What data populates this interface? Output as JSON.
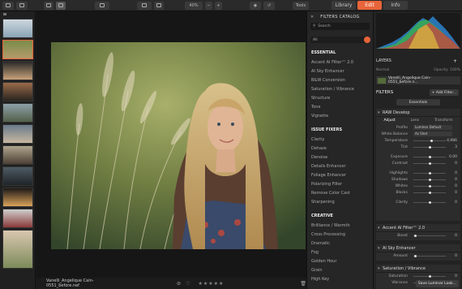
{
  "toolbar": {
    "zoom": "40%",
    "tools_label": "Tools",
    "tabs": [
      "Library",
      "Edit",
      "Info"
    ]
  },
  "canvas": {
    "filename": "Vanelli_Angelique Cain-0551_before.nef"
  },
  "catalog": {
    "title": "FILTERS CATALOG",
    "search_placeholder": "Search",
    "filter_value": "All",
    "sections": [
      {
        "name": "ESSENTIAL",
        "items": [
          "Accent AI Filter™ 2.0",
          "AI Sky Enhancer",
          "B&W Conversion",
          "Saturation / Vibrance",
          "Structure",
          "Tone",
          "Vignette"
        ]
      },
      {
        "name": "ISSUE FIXERS",
        "items": [
          "Clarity",
          "Dehaze",
          "Denoise",
          "Details Enhancer",
          "Foliage Enhancer",
          "Polarizing Filter",
          "Remove Color Cast",
          "Sharpening"
        ]
      },
      {
        "name": "CREATIVE",
        "items": [
          "Brilliance / Warmth",
          "Cross Processing",
          "Dramatic",
          "Fog",
          "Golden Hour",
          "Grain",
          "High Key"
        ]
      }
    ]
  },
  "right": {
    "layers_title": "LAYERS",
    "blend_mode": "Normal",
    "opacity": "Opacity: 100%",
    "layer_name": "Vanelli_Angelique Cain-0551_before.n...",
    "filters_title": "FILTERS",
    "add_filter": "+ Add Filter...",
    "preset": "Essentials",
    "raw": {
      "title": "RAW Develop",
      "tabs": [
        "Adjust",
        "Lens",
        "Transform"
      ],
      "profile_label": "Profile",
      "profile_value": "Luminar Default",
      "wb_label": "White Balance",
      "wb_value": "As Shot",
      "sliders": [
        {
          "label": "Temperature",
          "value": "4,986",
          "knob": 0.55
        },
        {
          "label": "Tint",
          "value": "3",
          "knob": 0.52
        },
        {
          "label": "Exposure",
          "value": "0.00",
          "knob": 0.5
        },
        {
          "label": "Contrast",
          "value": "0",
          "knob": 0.5
        },
        {
          "label": "Highlights",
          "value": "0",
          "knob": 0.5
        },
        {
          "label": "Shadows",
          "value": "0",
          "knob": 0.5
        },
        {
          "label": "Whites",
          "value": "0",
          "knob": 0.5
        },
        {
          "label": "Blacks",
          "value": "0",
          "knob": 0.5
        },
        {
          "label": "Clarity",
          "value": "0",
          "knob": 0.5
        }
      ]
    },
    "accent": {
      "title": "Accent AI Filter™ 2.0",
      "label": "Boost",
      "value": "0",
      "knob": 0.05
    },
    "sky": {
      "title": "AI Sky Enhancer",
      "label": "Amount",
      "value": "0",
      "knob": 0.05
    },
    "sat": {
      "title": "Saturation / Vibrance",
      "rows": [
        {
          "label": "Saturation",
          "value": "0",
          "knob": 0.5
        },
        {
          "label": "Vibrance",
          "value": "0",
          "knob": 0.5
        }
      ]
    },
    "save_button": "Save Luminar Look..."
  },
  "colors": {
    "accent": "#e8643a",
    "panel": "#232323"
  }
}
